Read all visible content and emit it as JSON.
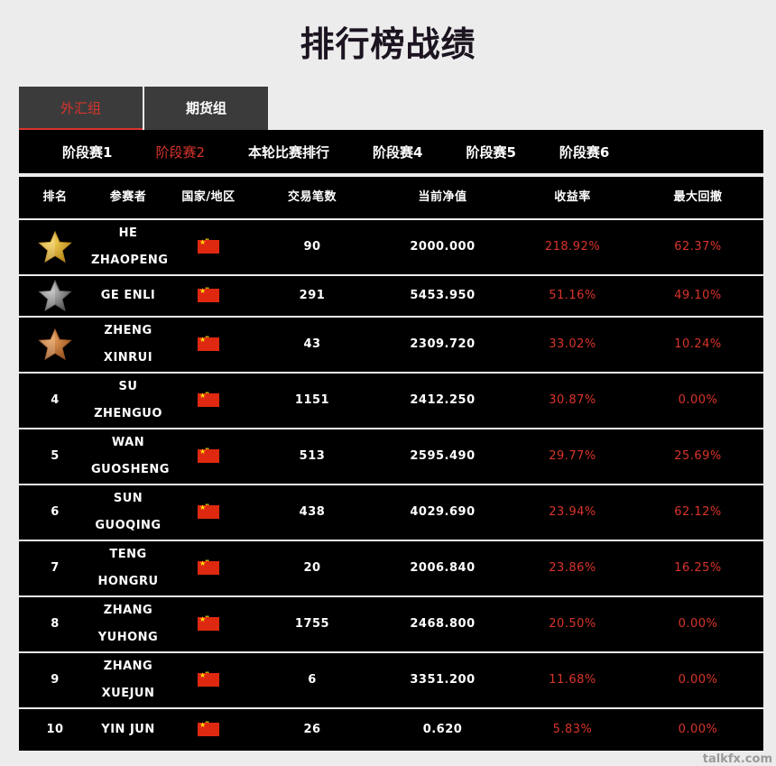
{
  "title": "排行榜战绩",
  "groups": [
    {
      "label": "外汇组",
      "active": true
    },
    {
      "label": "期货组",
      "active": false
    }
  ],
  "stages": [
    {
      "label": "阶段赛1",
      "active": false
    },
    {
      "label": "阶段赛2",
      "active": true
    },
    {
      "label": "本轮比赛排行",
      "active": false
    },
    {
      "label": "阶段赛4",
      "active": false
    },
    {
      "label": "阶段赛5",
      "active": false
    },
    {
      "label": "阶段赛6",
      "active": false
    }
  ],
  "columns": {
    "rank": "排名",
    "name": "参赛者",
    "country": "国家/地区",
    "trades": "交易笔数",
    "nav": "当前净值",
    "return": "收益率",
    "drawdown": "最大回撤"
  },
  "rows": [
    {
      "rank": "",
      "medal": "gold",
      "name_lines": [
        "HE",
        "ZHAOPENG"
      ],
      "country": "china-flag-icon",
      "trades": "90",
      "nav": "2000.000",
      "return": "218.92%",
      "drawdown": "62.37%"
    },
    {
      "rank": "",
      "medal": "silver",
      "name_lines": [
        "GE ENLI"
      ],
      "country": "china-flag-icon",
      "trades": "291",
      "nav": "5453.950",
      "return": "51.16%",
      "drawdown": "49.10%"
    },
    {
      "rank": "",
      "medal": "bronze",
      "name_lines": [
        "ZHENG",
        "XINRUI"
      ],
      "country": "china-flag-icon",
      "trades": "43",
      "nav": "2309.720",
      "return": "33.02%",
      "drawdown": "10.24%"
    },
    {
      "rank": "4",
      "medal": "",
      "name_lines": [
        "SU",
        "ZHENGUO"
      ],
      "country": "china-flag-icon",
      "trades": "1151",
      "nav": "2412.250",
      "return": "30.87%",
      "drawdown": "0.00%"
    },
    {
      "rank": "5",
      "medal": "",
      "name_lines": [
        "WAN",
        "GUOSHENG"
      ],
      "country": "china-flag-icon",
      "trades": "513",
      "nav": "2595.490",
      "return": "29.77%",
      "drawdown": "25.69%"
    },
    {
      "rank": "6",
      "medal": "",
      "name_lines": [
        "SUN",
        "GUOQING"
      ],
      "country": "china-flag-icon",
      "trades": "438",
      "nav": "4029.690",
      "return": "23.94%",
      "drawdown": "62.12%"
    },
    {
      "rank": "7",
      "medal": "",
      "name_lines": [
        "TENG",
        "HONGRU"
      ],
      "country": "china-flag-icon",
      "trades": "20",
      "nav": "2006.840",
      "return": "23.86%",
      "drawdown": "16.25%"
    },
    {
      "rank": "8",
      "medal": "",
      "name_lines": [
        "ZHANG",
        "YUHONG"
      ],
      "country": "china-flag-icon",
      "trades": "1755",
      "nav": "2468.800",
      "return": "20.50%",
      "drawdown": "0.00%"
    },
    {
      "rank": "9",
      "medal": "",
      "name_lines": [
        "ZHANG",
        "XUEJUN"
      ],
      "country": "china-flag-icon",
      "trades": "6",
      "nav": "3351.200",
      "return": "11.68%",
      "drawdown": "0.00%"
    },
    {
      "rank": "10",
      "medal": "",
      "name_lines": [
        "YIN JUN"
      ],
      "country": "china-flag-icon",
      "trades": "26",
      "nav": "0.620",
      "return": "5.83%",
      "drawdown": "0.00%"
    }
  ],
  "colors": {
    "accent_red": "#d9342b",
    "gold": "#d4a52a",
    "silver": "#8a8a8a",
    "bronze": "#c07a3a"
  },
  "watermark": "talkfx.com"
}
